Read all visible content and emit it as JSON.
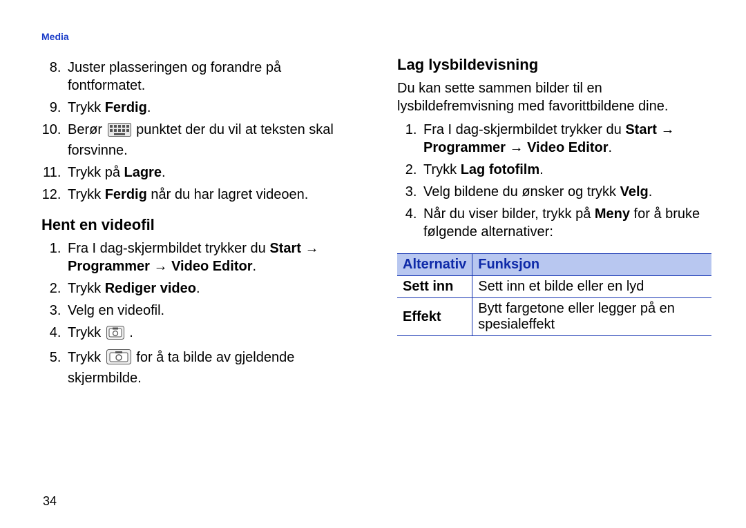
{
  "running_head": "Media",
  "page_number": "34",
  "left": {
    "top_start": 8,
    "top_items": [
      "Juster plasseringen og forandre på fontformatet.",
      [
        "Trykk ",
        [
          "b",
          "Ferdig"
        ],
        "."
      ],
      [
        "Berør ",
        [
          "icon",
          "keyboard"
        ],
        " punktet der du vil at teksten skal forsvinne."
      ],
      [
        "Trykk på ",
        [
          "b",
          "Lagre"
        ],
        "."
      ],
      [
        "Trykk ",
        [
          "b",
          "Ferdig"
        ],
        " når du har lagret videoen."
      ]
    ],
    "heading": "Hent en videofil",
    "bottom_start": 1,
    "bottom_items": [
      [
        "Fra I dag-skjermbildet trykker du ",
        [
          "b",
          "Start"
        ],
        " ",
        [
          "arrow"
        ],
        " ",
        [
          "b",
          "Programmer"
        ],
        " ",
        [
          "arrow"
        ],
        " ",
        [
          "b",
          "Video Editor"
        ],
        "."
      ],
      [
        "Trykk ",
        [
          "b",
          "Rediger video"
        ],
        "."
      ],
      "Velg en videofil.",
      [
        "Trykk ",
        [
          "icon",
          "camera-small"
        ],
        " ."
      ],
      [
        "Trykk ",
        [
          "icon",
          "camera-wide"
        ],
        " for å ta bilde av gjeldende skjermbilde."
      ]
    ]
  },
  "right": {
    "heading": "Lag lysbildevisning",
    "intro": "Du kan sette sammen bilder til en lysbildefremvisning med favorittbildene dine.",
    "list_start": 1,
    "list_items": [
      [
        "Fra I dag-skjermbildet trykker du ",
        [
          "b",
          "Start"
        ],
        " ",
        [
          "arrow"
        ],
        " ",
        [
          "b",
          "Programmer"
        ],
        " ",
        [
          "arrow"
        ],
        " ",
        [
          "b",
          "Video Editor"
        ],
        "."
      ],
      [
        "Trykk ",
        [
          "b",
          "Lag fotofilm"
        ],
        "."
      ],
      [
        "Velg bildene du ønsker og trykk ",
        [
          "b",
          "Velg"
        ],
        "."
      ],
      [
        "Når du viser bilder, trykk på ",
        [
          "b",
          "Meny"
        ],
        " for å bruke følgende alternativer:"
      ]
    ],
    "table": {
      "head": [
        "Alternativ",
        "Funksjon"
      ],
      "rows": [
        [
          "Sett inn",
          "Sett inn et bilde eller en lyd"
        ],
        [
          "Effekt",
          "Bytt fargetone eller legger på en spesialeffekt"
        ]
      ]
    }
  },
  "icons": {
    "arrow_glyph": "→"
  }
}
